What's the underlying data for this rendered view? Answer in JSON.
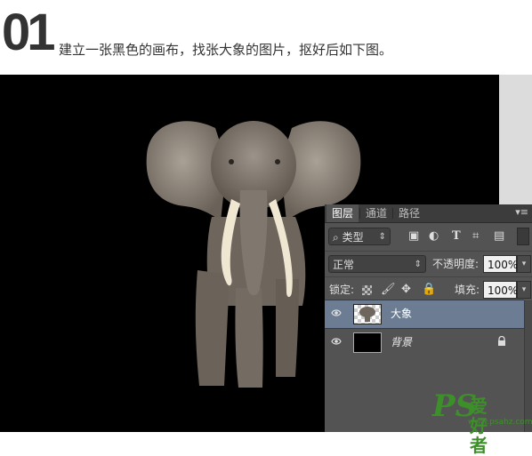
{
  "step": {
    "number": "01",
    "instruction": "建立一张黑色的画布，找张大象的图片，抠好后如下图。"
  },
  "panel": {
    "tabs": [
      "图层",
      "通道",
      "路径"
    ],
    "active_tab": "图层",
    "filter": {
      "icon": "search-icon",
      "label": "类型"
    },
    "filter_icons": [
      "image-filter-icon",
      "adjustment-filter-icon",
      "type-filter-icon",
      "shape-filter-icon",
      "smart-object-filter-icon"
    ],
    "blend_mode": "正常",
    "opacity_label": "不透明度:",
    "opacity_value": "100%",
    "lock_label": "锁定:",
    "lock_icons": [
      "lock-transparent-icon",
      "lock-paint-icon",
      "lock-position-icon",
      "lock-all-icon"
    ],
    "fill_label": "填充:",
    "fill_value": "100%",
    "layers": [
      {
        "name": "大象",
        "selected": true,
        "visible": true,
        "locked": false
      },
      {
        "name": "背景",
        "selected": false,
        "visible": true,
        "locked": true
      }
    ]
  },
  "watermark": {
    "ps": "PS",
    "cn": "爱好者",
    "url": "www.psahz.com",
    "color": "#3d8f2a"
  },
  "colors": {
    "canvas": "#000000",
    "panel_bg": "#535353",
    "selected_layer": "#6c7d93"
  }
}
